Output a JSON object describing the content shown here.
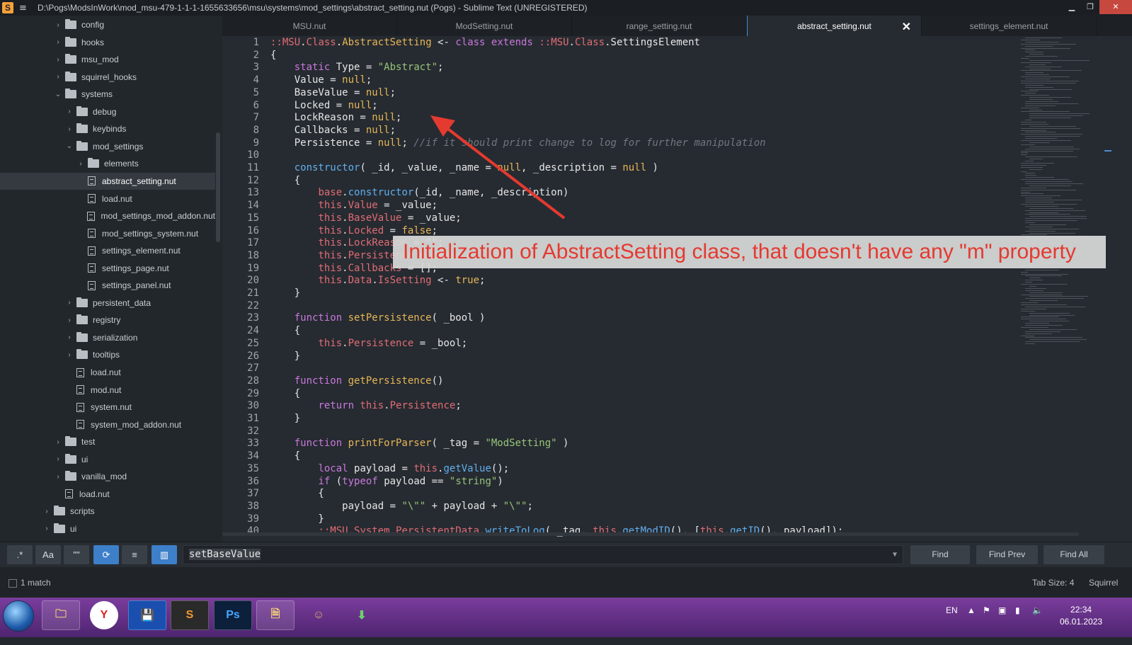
{
  "window": {
    "title": "D:\\Pogs\\ModsInWork\\mod_msu-479-1-1-1-1655633656\\msu\\systems\\mod_settings\\abstract_setting.nut (Pogs) - Sublime Text (UNREGISTERED)",
    "app_icon": "S"
  },
  "sidebar": {
    "items": [
      {
        "label": "config",
        "type": "folder",
        "depth": 1
      },
      {
        "label": "hooks",
        "type": "folder",
        "depth": 1
      },
      {
        "label": "msu_mod",
        "type": "folder",
        "depth": 1
      },
      {
        "label": "squirrel_hooks",
        "type": "folder",
        "depth": 1
      },
      {
        "label": "systems",
        "type": "folder-open",
        "depth": 1
      },
      {
        "label": "debug",
        "type": "folder",
        "depth": 2
      },
      {
        "label": "keybinds",
        "type": "folder",
        "depth": 2
      },
      {
        "label": "mod_settings",
        "type": "folder-open",
        "depth": 2
      },
      {
        "label": "elements",
        "type": "folder",
        "depth": 3
      },
      {
        "label": "abstract_setting.nut",
        "type": "file",
        "depth": 3,
        "selected": true
      },
      {
        "label": "load.nut",
        "type": "file",
        "depth": 3
      },
      {
        "label": "mod_settings_mod_addon.nut",
        "type": "file",
        "depth": 3
      },
      {
        "label": "mod_settings_system.nut",
        "type": "file",
        "depth": 3
      },
      {
        "label": "settings_element.nut",
        "type": "file",
        "depth": 3
      },
      {
        "label": "settings_page.nut",
        "type": "file",
        "depth": 3
      },
      {
        "label": "settings_panel.nut",
        "type": "file",
        "depth": 3
      },
      {
        "label": "persistent_data",
        "type": "folder",
        "depth": 2
      },
      {
        "label": "registry",
        "type": "folder",
        "depth": 2
      },
      {
        "label": "serialization",
        "type": "folder",
        "depth": 2
      },
      {
        "label": "tooltips",
        "type": "folder",
        "depth": 2
      },
      {
        "label": "load.nut",
        "type": "file",
        "depth": 2
      },
      {
        "label": "mod.nut",
        "type": "file",
        "depth": 2
      },
      {
        "label": "system.nut",
        "type": "file",
        "depth": 2
      },
      {
        "label": "system_mod_addon.nut",
        "type": "file",
        "depth": 2
      },
      {
        "label": "test",
        "type": "folder",
        "depth": 1
      },
      {
        "label": "ui",
        "type": "folder",
        "depth": 1
      },
      {
        "label": "vanilla_mod",
        "type": "folder",
        "depth": 1
      },
      {
        "label": "load.nut",
        "type": "file",
        "depth": 1
      },
      {
        "label": "scripts",
        "type": "folder",
        "depth": 0
      },
      {
        "label": "ui",
        "type": "folder",
        "depth": 0
      }
    ]
  },
  "tabs": [
    {
      "label": "MSU.nut",
      "active": false
    },
    {
      "label": "ModSetting.nut",
      "active": false
    },
    {
      "label": "range_setting.nut",
      "active": false
    },
    {
      "label": "abstract_setting.nut",
      "active": true
    },
    {
      "label": "settings_element.nut",
      "active": false
    }
  ],
  "editor": {
    "lines": [
      [
        [
          "t",
          "::MSU"
        ],
        [
          "o",
          "."
        ],
        [
          "t",
          "Class"
        ],
        [
          "o",
          "."
        ],
        [
          "n",
          "AbstractSetting"
        ],
        [
          "o",
          " <- "
        ],
        [
          "k",
          "class extends "
        ],
        [
          "t",
          "::MSU"
        ],
        [
          "o",
          "."
        ],
        [
          "t",
          "Class"
        ],
        [
          "o",
          "."
        ],
        [
          "o",
          "SettingsElement"
        ]
      ],
      [
        [
          "o",
          "{"
        ]
      ],
      [
        [
          "o",
          "    "
        ],
        [
          "k",
          "static "
        ],
        [
          "o",
          "Type = "
        ],
        [
          "s",
          "\"Abstract\""
        ],
        [
          "o",
          ";"
        ]
      ],
      [
        [
          "o",
          "    Value = "
        ],
        [
          "n",
          "null"
        ],
        [
          "o",
          ";"
        ]
      ],
      [
        [
          "o",
          "    BaseValue = "
        ],
        [
          "n",
          "null"
        ],
        [
          "o",
          ";"
        ]
      ],
      [
        [
          "o",
          "    Locked = "
        ],
        [
          "n",
          "null"
        ],
        [
          "o",
          ";"
        ]
      ],
      [
        [
          "o",
          "    LockReason = "
        ],
        [
          "n",
          "null"
        ],
        [
          "o",
          ";"
        ]
      ],
      [
        [
          "o",
          "    Callbacks = "
        ],
        [
          "n",
          "null"
        ],
        [
          "o",
          ";"
        ]
      ],
      [
        [
          "o",
          "    Persistence = "
        ],
        [
          "n",
          "null"
        ],
        [
          "o",
          "; "
        ],
        [
          "c",
          "//if it should print change to log for further manipulation"
        ]
      ],
      [
        [
          "o",
          ""
        ]
      ],
      [
        [
          "o",
          "    "
        ],
        [
          "f",
          "constructor"
        ],
        [
          "o",
          "( _id, _value, _name = "
        ],
        [
          "n",
          "null"
        ],
        [
          "o",
          ", _description = "
        ],
        [
          "n",
          "null"
        ],
        [
          "o",
          " )"
        ]
      ],
      [
        [
          "o",
          "    {"
        ]
      ],
      [
        [
          "o",
          "        "
        ],
        [
          "t",
          "base"
        ],
        [
          "o",
          "."
        ],
        [
          "f",
          "constructor"
        ],
        [
          "o",
          "(_id, _name, _description)"
        ]
      ],
      [
        [
          "o",
          "        "
        ],
        [
          "t",
          "this"
        ],
        [
          "o",
          "."
        ],
        [
          "t",
          "Value"
        ],
        [
          "o",
          " = _value;"
        ]
      ],
      [
        [
          "o",
          "        "
        ],
        [
          "t",
          "this"
        ],
        [
          "o",
          "."
        ],
        [
          "t",
          "BaseValue"
        ],
        [
          "o",
          " = _value;"
        ]
      ],
      [
        [
          "o",
          "        "
        ],
        [
          "t",
          "this"
        ],
        [
          "o",
          "."
        ],
        [
          "t",
          "Locked"
        ],
        [
          "o",
          " = "
        ],
        [
          "n",
          "false"
        ],
        [
          "o",
          ";"
        ]
      ],
      [
        [
          "o",
          "        "
        ],
        [
          "t",
          "this"
        ],
        [
          "o",
          "."
        ],
        [
          "t",
          "LockReason"
        ],
        [
          "o",
          " = \"\";"
        ]
      ],
      [
        [
          "o",
          "        "
        ],
        [
          "t",
          "this"
        ],
        [
          "o",
          "."
        ],
        [
          "t",
          "Persistence"
        ],
        [
          "o",
          " = "
        ],
        [
          "n",
          "true"
        ],
        [
          "o",
          ";"
        ]
      ],
      [
        [
          "o",
          "        "
        ],
        [
          "t",
          "this"
        ],
        [
          "o",
          "."
        ],
        [
          "t",
          "Callbacks"
        ],
        [
          "o",
          " = [];"
        ]
      ],
      [
        [
          "o",
          "        "
        ],
        [
          "t",
          "this"
        ],
        [
          "o",
          "."
        ],
        [
          "t",
          "Data"
        ],
        [
          "o",
          "."
        ],
        [
          "t",
          "IsSetting"
        ],
        [
          "o",
          " <- "
        ],
        [
          "n",
          "true"
        ],
        [
          "o",
          ";"
        ]
      ],
      [
        [
          "o",
          "    }"
        ]
      ],
      [
        [
          "o",
          ""
        ]
      ],
      [
        [
          "o",
          "    "
        ],
        [
          "k",
          "function "
        ],
        [
          "n",
          "setPersistence"
        ],
        [
          "o",
          "( _bool )"
        ]
      ],
      [
        [
          "o",
          "    {"
        ]
      ],
      [
        [
          "o",
          "        "
        ],
        [
          "t",
          "this"
        ],
        [
          "o",
          "."
        ],
        [
          "t",
          "Persistence"
        ],
        [
          "o",
          " = _bool;"
        ]
      ],
      [
        [
          "o",
          "    }"
        ]
      ],
      [
        [
          "o",
          ""
        ]
      ],
      [
        [
          "o",
          "    "
        ],
        [
          "k",
          "function "
        ],
        [
          "n",
          "getPersistence"
        ],
        [
          "o",
          "()"
        ]
      ],
      [
        [
          "o",
          "    {"
        ]
      ],
      [
        [
          "o",
          "        "
        ],
        [
          "k",
          "return "
        ],
        [
          "t",
          "this"
        ],
        [
          "o",
          "."
        ],
        [
          "t",
          "Persistence"
        ],
        [
          "o",
          ";"
        ]
      ],
      [
        [
          "o",
          "    }"
        ]
      ],
      [
        [
          "o",
          ""
        ]
      ],
      [
        [
          "o",
          "    "
        ],
        [
          "k",
          "function "
        ],
        [
          "n",
          "printForParser"
        ],
        [
          "o",
          "( _tag = "
        ],
        [
          "s",
          "\"ModSetting\""
        ],
        [
          "o",
          " )"
        ]
      ],
      [
        [
          "o",
          "    {"
        ]
      ],
      [
        [
          "o",
          "        "
        ],
        [
          "k",
          "local "
        ],
        [
          "o",
          "payload = "
        ],
        [
          "t",
          "this"
        ],
        [
          "o",
          "."
        ],
        [
          "f",
          "getValue"
        ],
        [
          "o",
          "();"
        ]
      ],
      [
        [
          "o",
          "        "
        ],
        [
          "k",
          "if "
        ],
        [
          "o",
          "("
        ],
        [
          "k",
          "typeof "
        ],
        [
          "o",
          "payload == "
        ],
        [
          "s",
          "\"string\""
        ],
        [
          "o",
          ")"
        ]
      ],
      [
        [
          "o",
          "        {"
        ]
      ],
      [
        [
          "o",
          "            payload = "
        ],
        [
          "s",
          "\"\\\"\""
        ],
        [
          "o",
          " + payload + "
        ],
        [
          "s",
          "\"\\\"\""
        ],
        [
          "o",
          ";"
        ]
      ],
      [
        [
          "o",
          "        }"
        ]
      ],
      [
        [
          "o",
          "        "
        ],
        [
          "t",
          "::MSU.System.PersistentData"
        ],
        [
          "o",
          "."
        ],
        [
          "f",
          "writeToLog"
        ],
        [
          "o",
          "( _tag, "
        ],
        [
          "t",
          "this"
        ],
        [
          "o",
          "."
        ],
        [
          "f",
          "getModID"
        ],
        [
          "o",
          "(), ["
        ],
        [
          "t",
          "this"
        ],
        [
          "o",
          "."
        ],
        [
          "f",
          "getID"
        ],
        [
          "o",
          "(), payload]);"
        ]
      ]
    ]
  },
  "annotation": {
    "text": "Initialization of AbstractSetting class, that doesn't have any \"m\" property",
    "color": "#e43a2f"
  },
  "findbar": {
    "toggles": [
      {
        "name": "regex-toggle",
        "label": ".*",
        "on": false
      },
      {
        "name": "case-toggle",
        "label": "Aa",
        "on": false
      },
      {
        "name": "whole-word-toggle",
        "label": "\"\"",
        "on": false
      },
      {
        "name": "wrap-toggle",
        "label": "⟳",
        "on": true
      },
      {
        "name": "in-selection-toggle",
        "label": "≡",
        "on": false
      },
      {
        "name": "highlight-toggle",
        "label": "▥",
        "on": true
      }
    ],
    "query": "setBaseValue",
    "find_label": "Find",
    "find_prev_label": "Find Prev",
    "find_all_label": "Find All"
  },
  "status": {
    "matches": "1 match",
    "tab_size": "Tab Size: 4",
    "syntax": "Squirrel"
  },
  "taskbar": {
    "apps": [
      {
        "name": "explorer-app",
        "label": "🗀"
      },
      {
        "name": "yandex-browser-app",
        "label": "Y"
      },
      {
        "name": "floppy-app",
        "label": "💾"
      },
      {
        "name": "sublime-app",
        "label": "S"
      },
      {
        "name": "photoshop-app",
        "label": "Ps"
      },
      {
        "name": "file-app",
        "label": "🗎"
      },
      {
        "name": "game-app",
        "label": "☺"
      },
      {
        "name": "download-app",
        "label": "⬇"
      }
    ],
    "language": "EN",
    "time": "22:34",
    "date": "06.01.2023"
  }
}
